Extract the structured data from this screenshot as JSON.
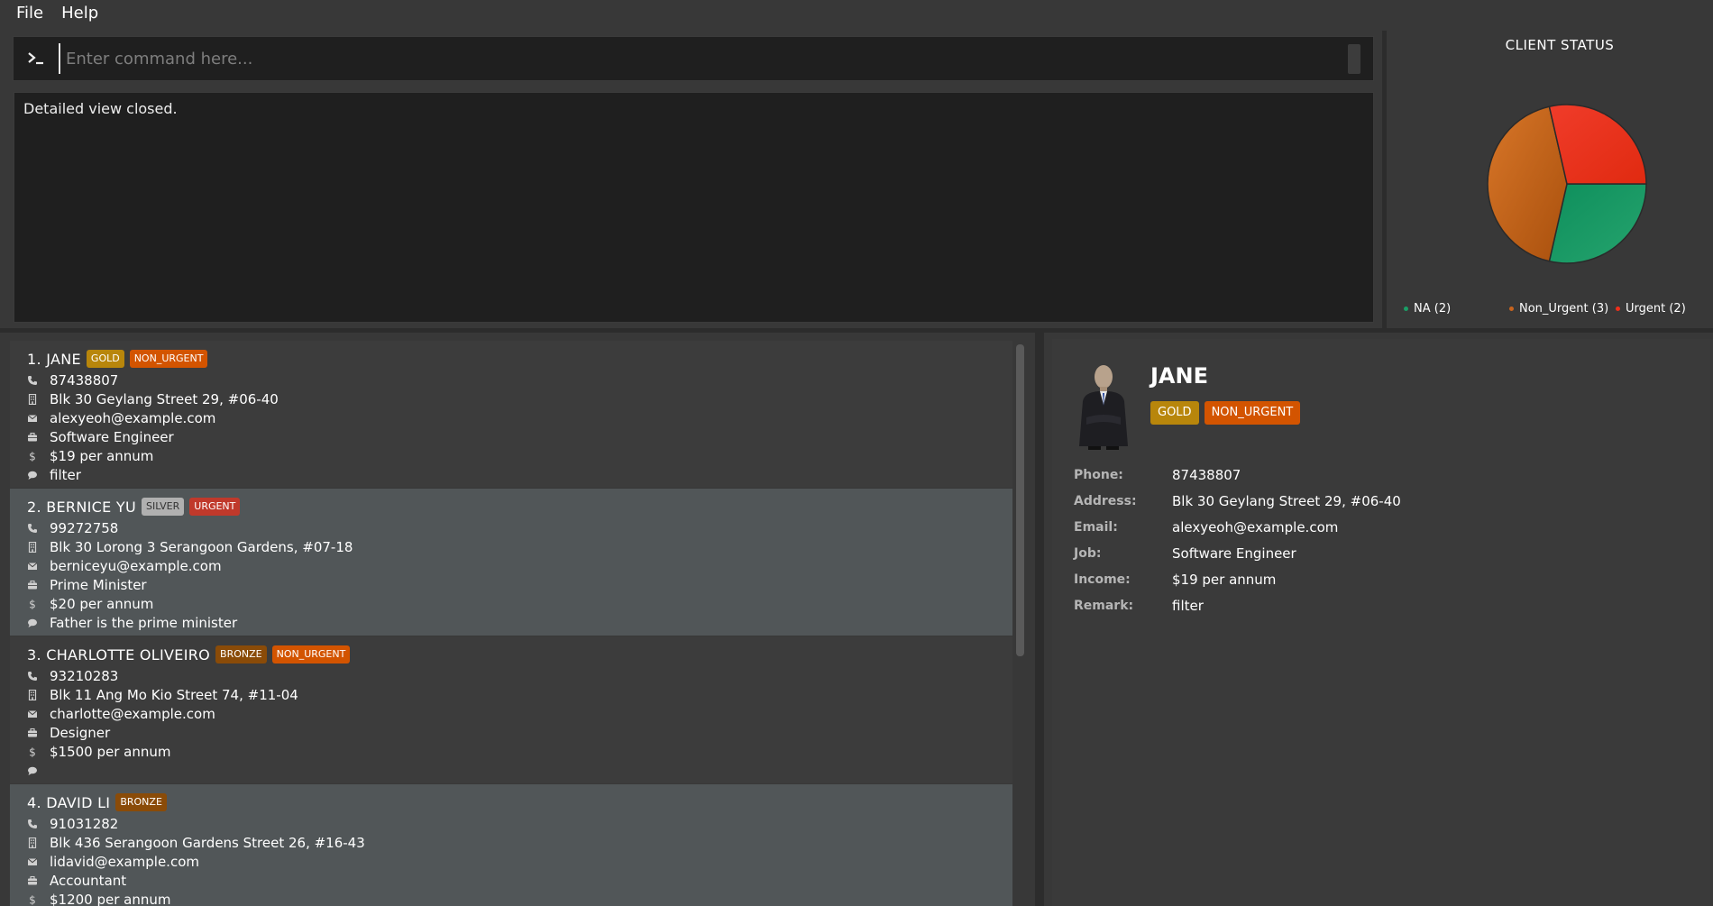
{
  "menu": {
    "items": [
      "File",
      "Help"
    ]
  },
  "command": {
    "prompt_icon": "terminal-icon",
    "placeholder": "Enter command here..."
  },
  "result": {
    "text": "Detailed view closed."
  },
  "chart": {
    "title": "CLIENT STATUS",
    "colors": {
      "NA": "#1a9e66",
      "Non_Urgent": "#c8641e",
      "Urgent": "#f02f1a"
    },
    "legend": [
      "NA (2)",
      "Non_Urgent (3)",
      "Urgent (2)"
    ]
  },
  "chart_data": {
    "type": "pie",
    "title": "CLIENT STATUS",
    "categories": [
      "NA",
      "Non_Urgent",
      "Urgent"
    ],
    "values": [
      2,
      3,
      2
    ],
    "legend_position": "bottom"
  },
  "persons": [
    {
      "index_name": "1. JANE",
      "tags": [
        {
          "label": "GOLD",
          "kind": "gold"
        },
        {
          "label": "NON_URGENT",
          "kind": "nonurgent"
        }
      ],
      "phone": "87438807",
      "address": "Blk 30 Geylang Street 29, #06-40",
      "email": "alexyeoh@example.com",
      "job": "Software Engineer",
      "income": "$19 per annum",
      "remark": "filter"
    },
    {
      "index_name": "2. BERNICE YU",
      "tags": [
        {
          "label": "SILVER",
          "kind": "silver"
        },
        {
          "label": "URGENT",
          "kind": "urgent"
        }
      ],
      "phone": "99272758",
      "address": "Blk 30 Lorong 3 Serangoon Gardens, #07-18",
      "email": "berniceyu@example.com",
      "job": "Prime Minister",
      "income": "$20 per annum",
      "remark": "Father is the prime minister"
    },
    {
      "index_name": "3. CHARLOTTE OLIVEIRO",
      "tags": [
        {
          "label": "BRONZE",
          "kind": "bronze"
        },
        {
          "label": "NON_URGENT",
          "kind": "nonurgent"
        }
      ],
      "phone": "93210283",
      "address": "Blk 11 Ang Mo Kio Street 74, #11-04",
      "email": "charlotte@example.com",
      "job": "Designer",
      "income": "$1500 per annum",
      "remark": ""
    },
    {
      "index_name": "4. DAVID LI",
      "tags": [
        {
          "label": "BRONZE",
          "kind": "bronze"
        }
      ],
      "phone": "91031282",
      "address": "Blk 436 Serangoon Gardens Street 26, #16-43",
      "email": "lidavid@example.com",
      "job": "Accountant",
      "income": "$1200 per annum",
      "remark": ""
    }
  ],
  "detail": {
    "name": "JANE",
    "tags": [
      {
        "label": "GOLD",
        "kind": "gold"
      },
      {
        "label": "NON_URGENT",
        "kind": "nonurgent"
      }
    ],
    "rows": [
      {
        "label": "Phone:",
        "value": "87438807"
      },
      {
        "label": "Address:",
        "value": "Blk 30 Geylang Street 29, #06-40"
      },
      {
        "label": "Email:",
        "value": "alexyeoh@example.com"
      },
      {
        "label": "Job:",
        "value": "Software Engineer"
      },
      {
        "label": "Income:",
        "value": "$19 per annum"
      },
      {
        "label": "Remark:",
        "value": "filter"
      }
    ]
  }
}
